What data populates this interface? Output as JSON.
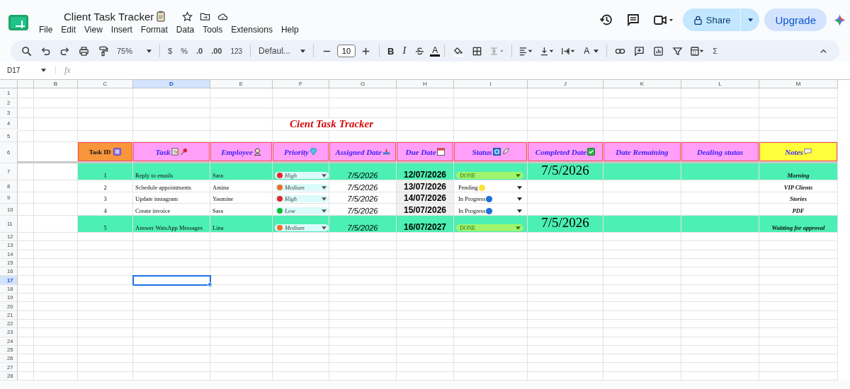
{
  "title": "Client Task Tracker",
  "menu": [
    "File",
    "Edit",
    "View",
    "Insert",
    "Format",
    "Data",
    "Tools",
    "Extensions",
    "Help"
  ],
  "share": "Share",
  "upgrade": "Upgrade",
  "toolbar": {
    "zoom": "75%",
    "currency": "$",
    "percent": "%",
    "dec_less": ".0",
    "dec_more": ".00",
    "number_format": "123",
    "font": "Defaul...",
    "font_size": "10",
    "bold": "B",
    "italic": "I",
    "text_color": "A",
    "rotate": "A",
    "sum": "Σ"
  },
  "name_box": "D17",
  "formula_label": "fx",
  "columns": [
    {
      "label": "B",
      "selected": false
    },
    {
      "label": "C",
      "selected": false
    },
    {
      "label": "D",
      "selected": true
    },
    {
      "label": "E",
      "selected": false
    },
    {
      "label": "F",
      "selected": false
    },
    {
      "label": "G",
      "selected": false
    },
    {
      "label": "H",
      "selected": false
    },
    {
      "label": "I",
      "selected": false
    },
    {
      "label": "J",
      "selected": false
    },
    {
      "label": "K",
      "selected": false
    },
    {
      "label": "L",
      "selected": false
    },
    {
      "label": "M",
      "selected": false
    }
  ],
  "rows": [
    {
      "label": "1",
      "selected": false
    },
    {
      "label": "2",
      "selected": false
    },
    {
      "label": "3",
      "selected": false
    },
    {
      "label": "4",
      "selected": false
    },
    {
      "label": "5",
      "selected": false
    },
    {
      "label": "6",
      "selected": false
    },
    {
      "label": "7",
      "selected": false
    },
    {
      "label": "8",
      "selected": false
    },
    {
      "label": "9",
      "selected": false
    },
    {
      "label": "10",
      "selected": false
    },
    {
      "label": "11",
      "selected": false
    },
    {
      "label": "12",
      "selected": false
    },
    {
      "label": "13",
      "selected": false
    },
    {
      "label": "14",
      "selected": false
    },
    {
      "label": "15",
      "selected": false
    },
    {
      "label": "16",
      "selected": false
    },
    {
      "label": "17",
      "selected": true
    },
    {
      "label": "18",
      "selected": false
    },
    {
      "label": "19",
      "selected": false
    },
    {
      "label": "20",
      "selected": false
    },
    {
      "label": "21",
      "selected": false
    },
    {
      "label": "22",
      "selected": false
    },
    {
      "label": "23",
      "selected": false
    },
    {
      "label": "24",
      "selected": false
    },
    {
      "label": "25",
      "selected": false
    },
    {
      "label": "26",
      "selected": false
    },
    {
      "label": "27",
      "selected": false
    },
    {
      "label": "28",
      "selected": false
    }
  ],
  "sheet": {
    "title": "Cient Task Tracker",
    "headers": [
      {
        "label": "Task ID",
        "color": "#f7963a"
      },
      {
        "label": "Task",
        "color": "#ff9ff7"
      },
      {
        "label": "Employee",
        "color": "#ff9ff7"
      },
      {
        "label": "Priority",
        "color": "#ff9ff7"
      },
      {
        "label": "Assigned Date",
        "color": "#ff9ff7"
      },
      {
        "label": "Due Date",
        "color": "#ff9ff7"
      },
      {
        "label": "Status",
        "color": "#ff9ff7"
      },
      {
        "label": "Completed Date",
        "color": "#ff9ff7"
      },
      {
        "label": "Date  Remaining",
        "color": "#ff9ff7"
      },
      {
        "label": "Dealing stutas",
        "color": "#ff9ff7"
      },
      {
        "label": "Notes",
        "color": "#ffff3c"
      }
    ],
    "records": [
      {
        "id": "1",
        "task": "Reply to emails",
        "employee": "Sara",
        "priority": {
          "label": "High",
          "color": "#e3262f"
        },
        "assigned": "7/5/2026",
        "due": "12/07/2026",
        "status": {
          "kind": "chip",
          "label": "DONE"
        },
        "completed": "7/5/2026",
        "notes": "Morning",
        "highlighted": true
      },
      {
        "id": "2",
        "task": "Schedule appointments",
        "employee": "Amina",
        "priority": {
          "label": "Medium",
          "color": "#f26b2a"
        },
        "assigned": "7/5/2026",
        "due": "13/07/2026",
        "status": {
          "kind": "plain",
          "label": "Pending",
          "color": "#ffe033"
        },
        "notes": "VIP Clients",
        "highlighted": false
      },
      {
        "id": "3",
        "task": "Update instagram",
        "employee": "Yasmine",
        "priority": {
          "label": "High",
          "color": "#e3262f"
        },
        "assigned": "7/5/2026",
        "due": "14/07/2026",
        "status": {
          "kind": "plain",
          "label": "In Progress",
          "color": "#1e6fd9"
        },
        "notes": "Stories",
        "highlighted": false
      },
      {
        "id": "4",
        "task": "Create invoice",
        "employee": "Sara",
        "priority": {
          "label": "Low",
          "color": "#17b53a"
        },
        "assigned": "7/5/2026",
        "due": "15/07/2026",
        "status": {
          "kind": "plain",
          "label": "In Progress",
          "color": "#1e6fd9"
        },
        "notes": "PDF",
        "highlighted": false
      },
      {
        "id": "5",
        "task": "Answer WatsApp Messages",
        "employee": "Lina",
        "priority": {
          "label": "Medium",
          "color": "#f26b2a"
        },
        "assigned": "7/5/2026",
        "due": "16/07/2027",
        "status": {
          "kind": "chip",
          "label": "DONE"
        },
        "completed": "7/5/2026",
        "notes": "Waitting for approval",
        "highlighted": true
      }
    ]
  }
}
